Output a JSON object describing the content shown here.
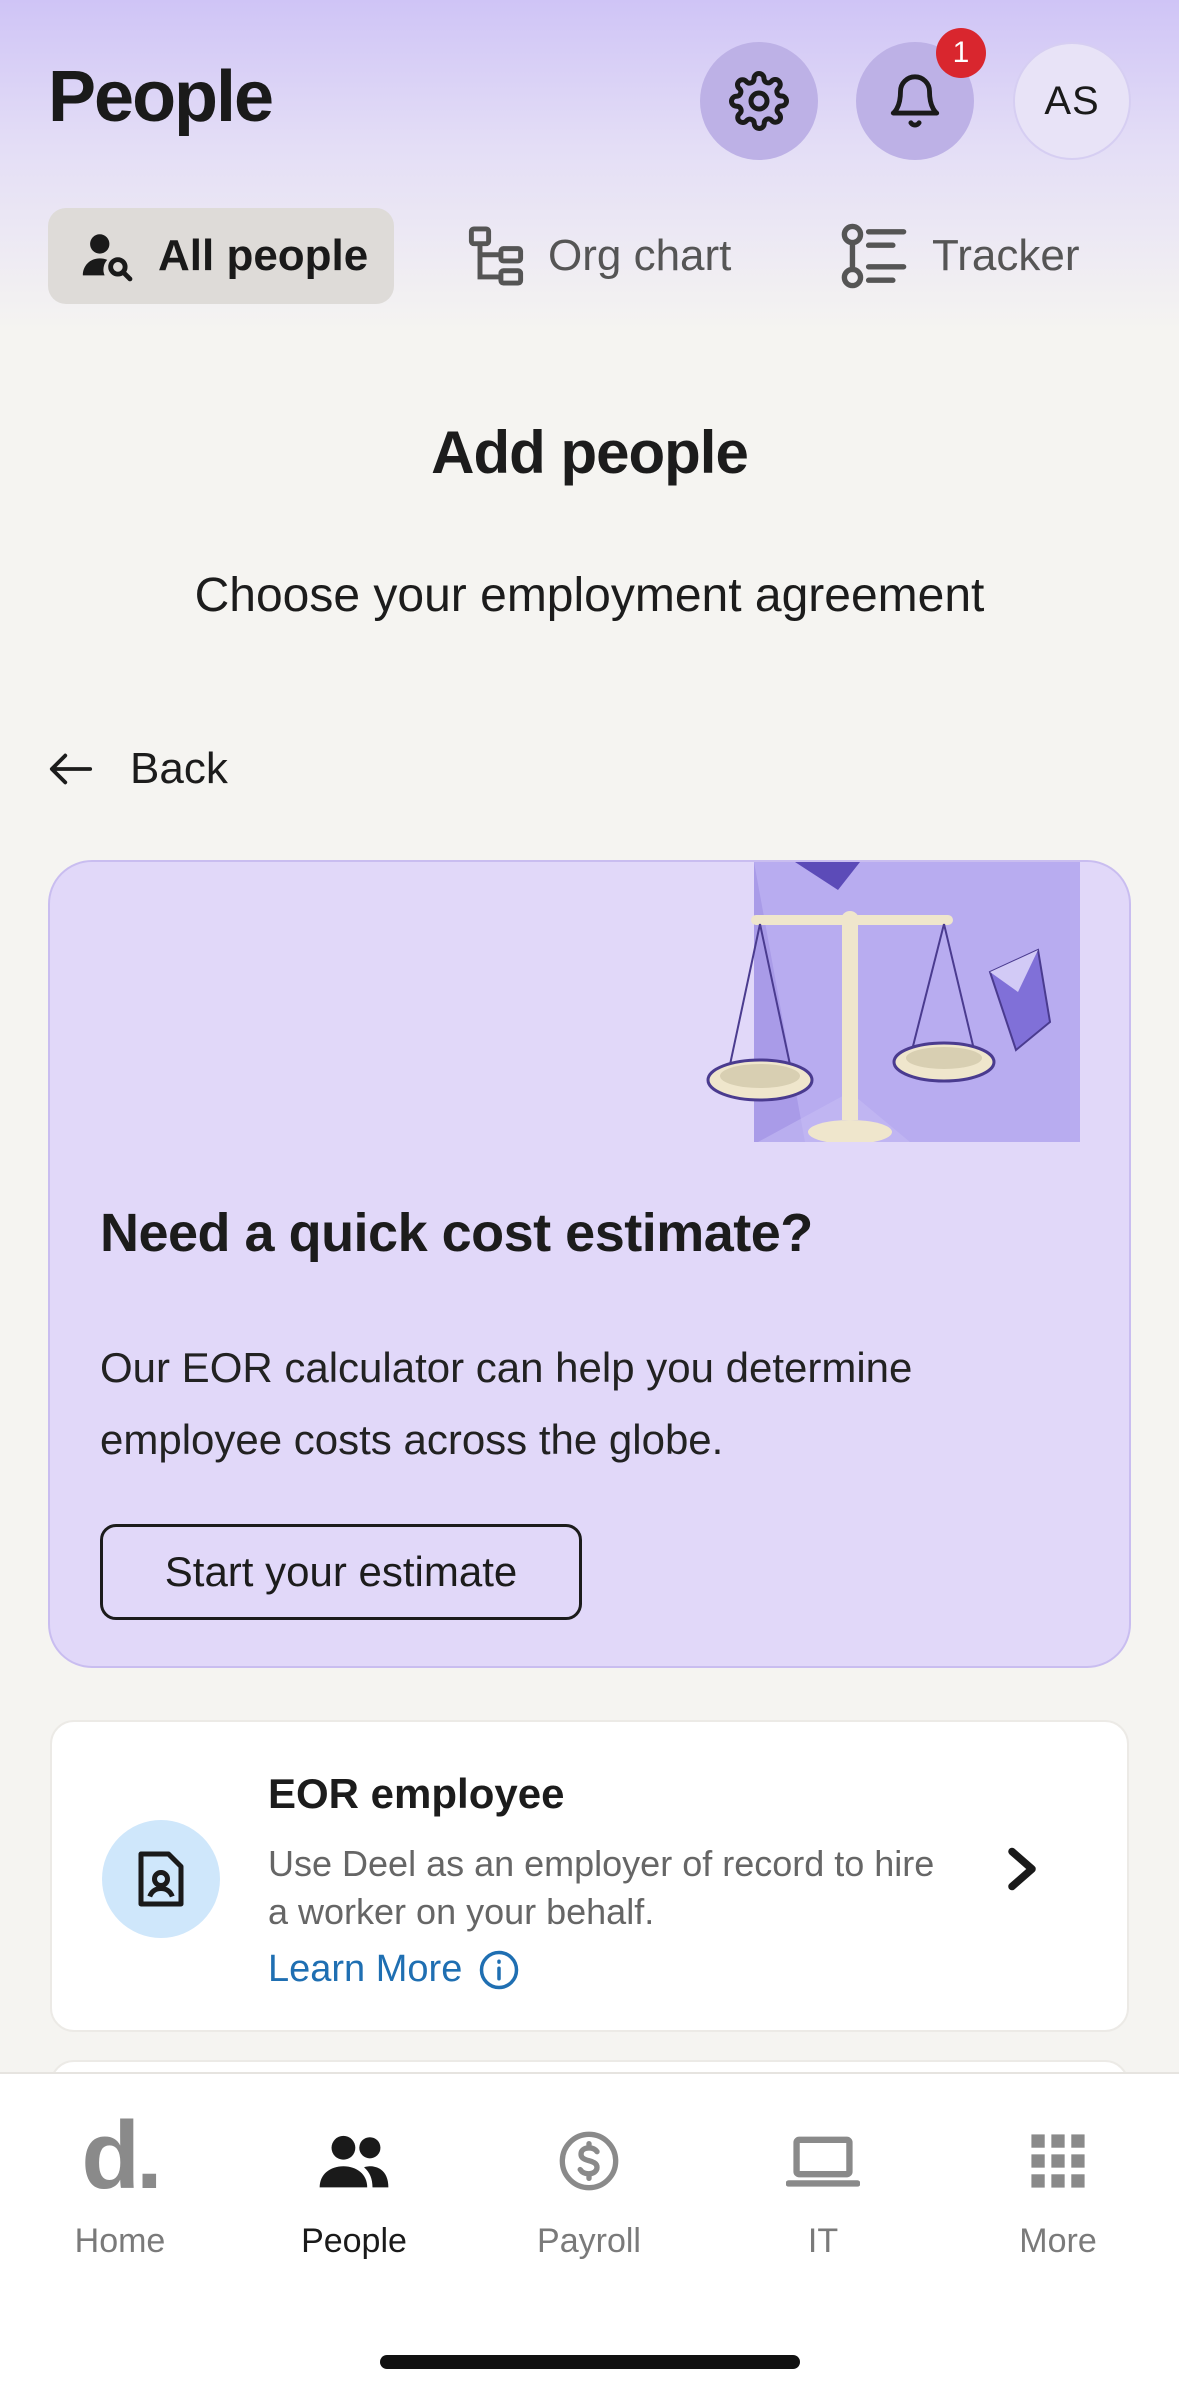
{
  "header": {
    "title": "People",
    "notification_count": "1",
    "avatar_initials": "AS"
  },
  "tabs": [
    {
      "label": "All people",
      "icon": "user-search-icon",
      "active": true
    },
    {
      "label": "Org chart",
      "icon": "org-chart-icon",
      "active": false
    },
    {
      "label": "Tracker",
      "icon": "tracker-list-icon",
      "active": false
    }
  ],
  "main": {
    "title": "Add people",
    "subtitle": "Choose your employment agreement",
    "back_label": "Back"
  },
  "promo": {
    "title": "Need a quick cost estimate?",
    "body": "Our EOR calculator can help you determine employee costs across the globe.",
    "button_label": "Start your estimate",
    "illustration": "scales-illustration"
  },
  "options": [
    {
      "title": "EOR employee",
      "description": "Use Deel as an employer of record to hire a worker on your behalf.",
      "link_label": "Learn More",
      "icon": "contract-document-icon"
    }
  ],
  "bottom_nav": [
    {
      "label": "Home",
      "icon": "deel-logo-icon",
      "active": false
    },
    {
      "label": "People",
      "icon": "people-icon",
      "active": true
    },
    {
      "label": "Payroll",
      "icon": "dollar-circle-icon",
      "active": false
    },
    {
      "label": "IT",
      "icon": "laptop-icon",
      "active": false
    },
    {
      "label": "More",
      "icon": "grid-icon",
      "active": false
    }
  ],
  "colors": {
    "accent_purple": "#e1d8f9",
    "header_gradient_top": "#cfc4f6",
    "badge_red": "#d9262e",
    "link_blue": "#1f6fb2",
    "icon_bubble_blue": "#cfe7fb",
    "background": "#f5f4f1"
  }
}
